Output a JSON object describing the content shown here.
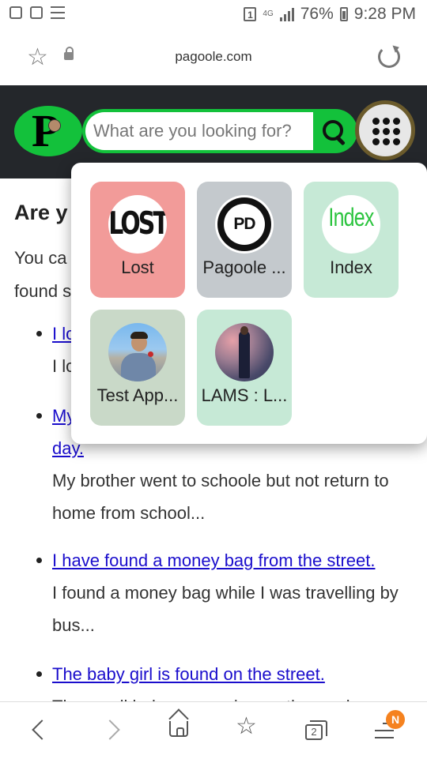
{
  "status_bar": {
    "network": "4G",
    "battery": "76%",
    "time": "9:28 PM",
    "sim": "1"
  },
  "browser": {
    "url": "pagoole.com"
  },
  "site": {
    "logo_letter": "P",
    "search_placeholder": "What are you looking for?"
  },
  "content": {
    "heading": "Are y",
    "intro_line1": "You ca",
    "intro_line2": "found s",
    "items": [
      {
        "title": "I lo",
        "desc": "I lo"
      },
      {
        "title": "My",
        "title2": "day.",
        "desc": "My brother went to schoole but not return to home from school..."
      },
      {
        "title": "I have found a money bag from the street.",
        "desc": "I found a money bag while I was travelling by bus..."
      },
      {
        "title": "The baby girl is found on the street.",
        "desc": "The small baby was crying on the road"
      }
    ]
  },
  "apps_menu": {
    "apps": [
      {
        "label": "Lost",
        "thumb_text": "LOST",
        "bg": "#f29b99"
      },
      {
        "label": "Pagoole ...",
        "thumb_text": "PD",
        "bg": "#c4c9cd"
      },
      {
        "label": "Index",
        "thumb_text": "Index",
        "bg": "#c6e9d6"
      },
      {
        "label": "Test App...",
        "bg": "#c9d9c8"
      },
      {
        "label": "LAMS : L...",
        "bg": "#c6e9d6"
      }
    ]
  },
  "bottom_nav": {
    "tab_count": "2",
    "menu_badge": "N"
  },
  "colors": {
    "brand_green": "#13c13b",
    "header_bg": "#24272b",
    "link": "#1a0dcc",
    "badge": "#f5821f"
  }
}
